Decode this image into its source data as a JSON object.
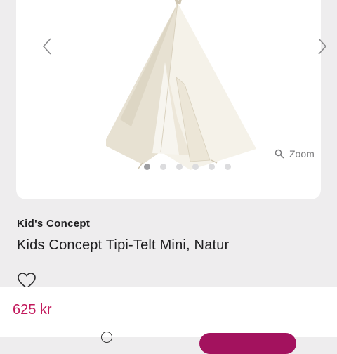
{
  "product": {
    "brand": "Kid's Concept",
    "title": "Kids Concept Tipi-Telt Mini, Natur"
  },
  "gallery": {
    "zoom_label": "Zoom",
    "dot_count": 6,
    "active_index": 0,
    "icons": {
      "prev": "chevron-left-icon",
      "next": "chevron-right-icon",
      "zoom": "search-icon"
    }
  },
  "purchase": {
    "price": "625 kr",
    "favorite_icon": "heart-icon",
    "accent_color": "#a3125e",
    "price_color": "#c2185b"
  }
}
